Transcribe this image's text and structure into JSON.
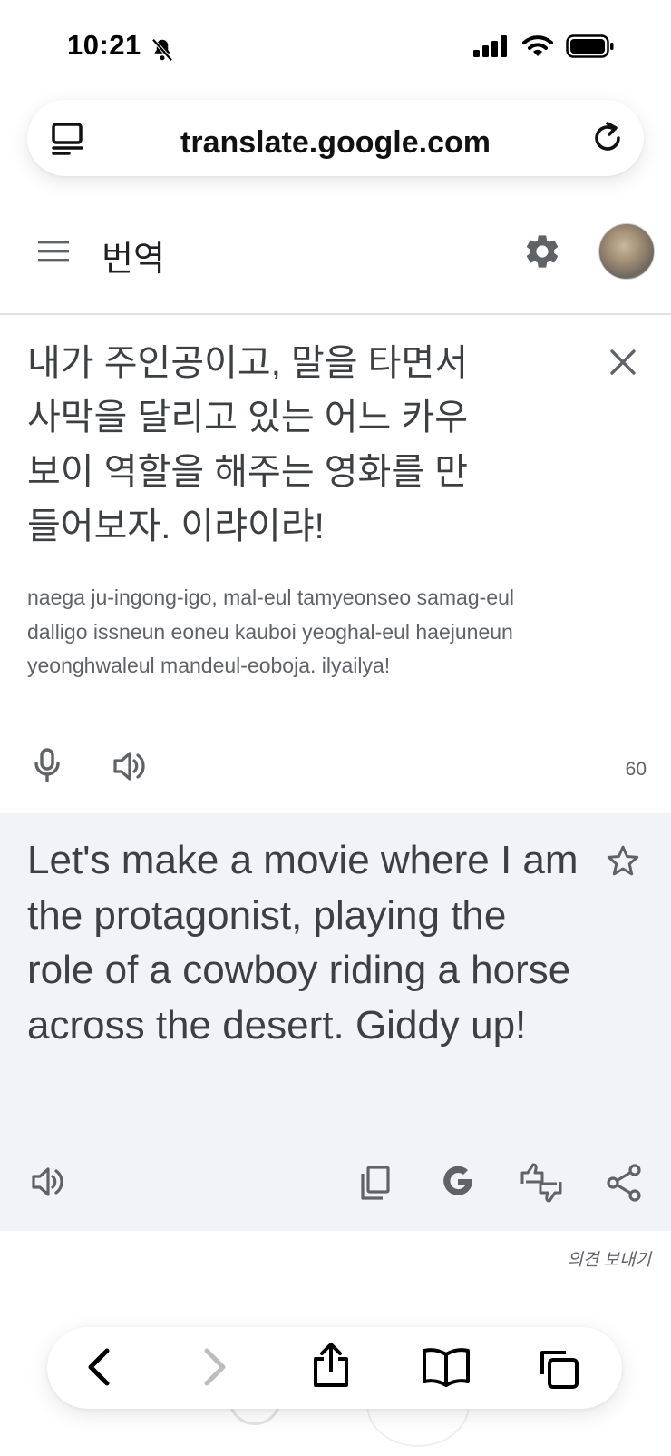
{
  "status_bar": {
    "time": "10:21"
  },
  "browser": {
    "url": "translate.google.com"
  },
  "app": {
    "title": "번역"
  },
  "source": {
    "text": "내가 주인공이고, 말을 타면서 사막을 달리고 있는 어느 카우보이 역할을 해주는 영화를 만들어보자. 이랴이랴!",
    "romanization": "naega ju-ingong-igo, mal-eul tamyeonseo samag-eul dalligo issneun eoneu kauboi yeoghal-eul haejuneun yeonghwaleul mandeul-eoboja. ilyailya!",
    "char_count": "60"
  },
  "translation": {
    "text": "Let's make a movie where I am the protagonist, playing the role of a cowboy riding a horse across the desert. Giddy up!"
  },
  "feedback_label": "의견 보내기",
  "icons": {
    "status": [
      "bell-slash-icon",
      "cellular-signal-icon",
      "wifi-icon",
      "battery-icon"
    ],
    "browser": [
      "reader-icon",
      "reload-icon"
    ],
    "header": [
      "menu-icon",
      "settings-icon"
    ],
    "source_actions": [
      "clear-icon",
      "microphone-icon",
      "speaker-icon"
    ],
    "translation_actions": [
      "star-icon",
      "speaker-icon",
      "copy-icon",
      "google-icon",
      "rate-icon",
      "share-icon"
    ],
    "safari_toolbar": [
      "back-icon",
      "forward-icon",
      "share-icon",
      "bookmarks-icon",
      "tabs-icon"
    ]
  },
  "colors": {
    "translation_background": "#f0f3f7",
    "text_primary": "#3c4043",
    "text_secondary": "#5f6368"
  }
}
